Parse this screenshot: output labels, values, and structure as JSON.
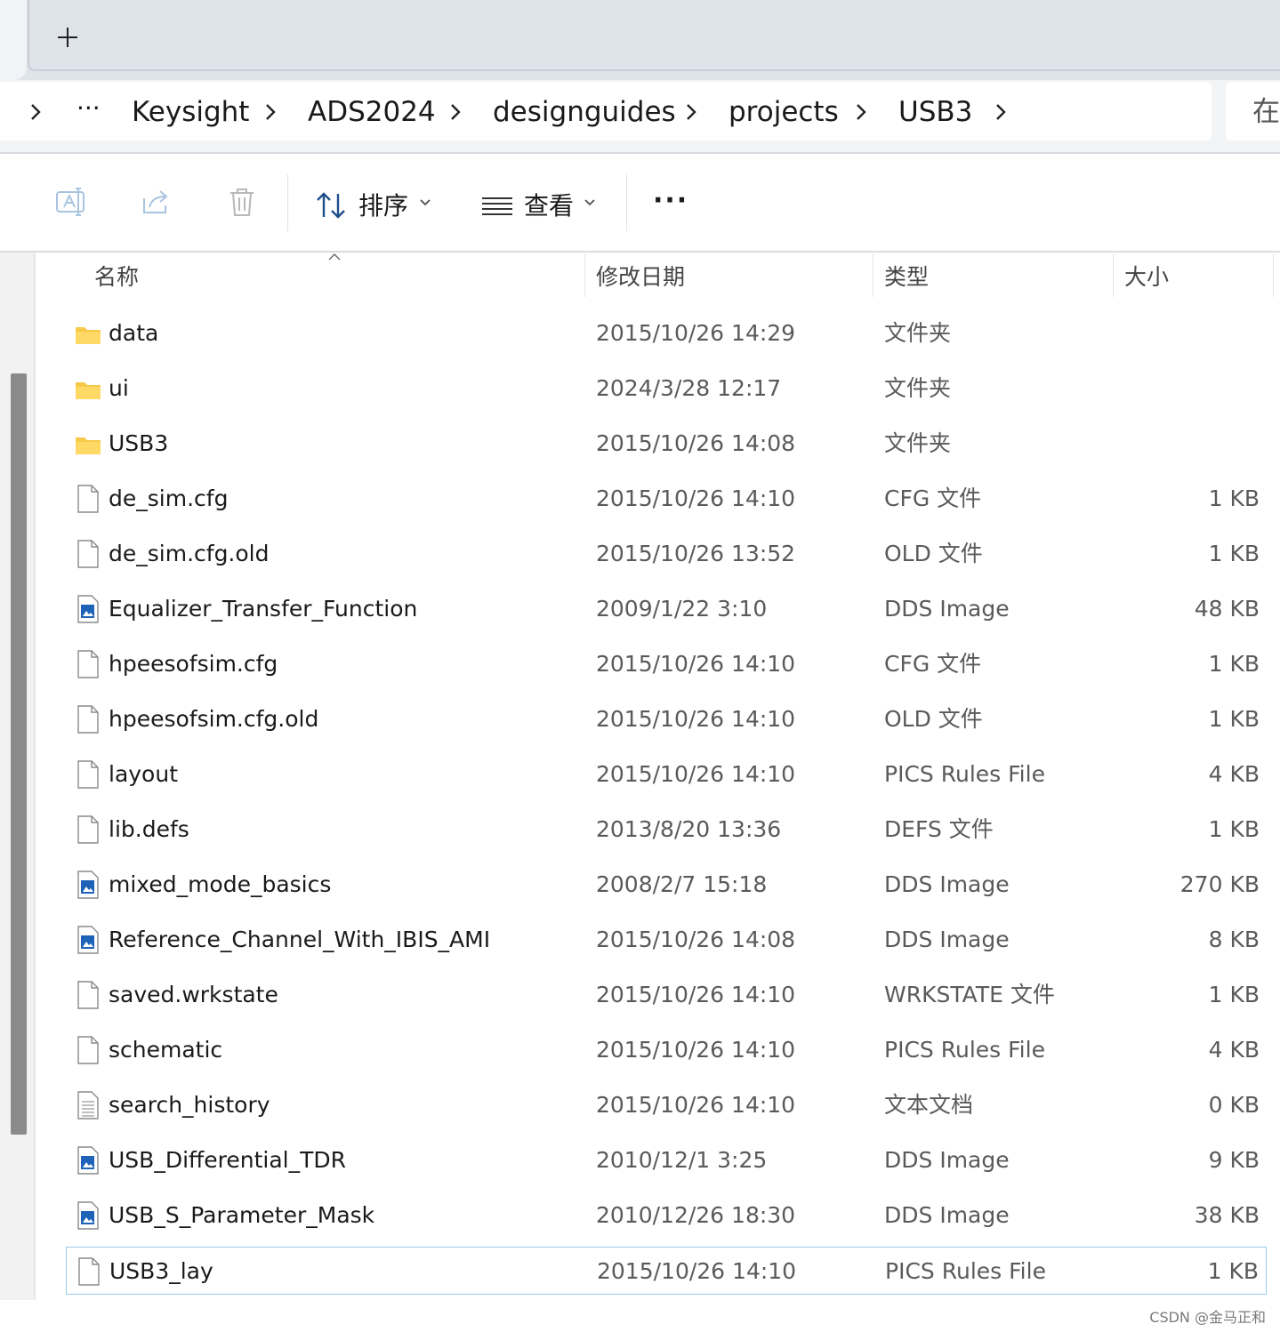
{
  "tabs": {
    "new_tab_icon": "plus-icon"
  },
  "breadcrumb": {
    "overflow": "···",
    "items": [
      "Keysight",
      "ADS2024",
      "designguides",
      "projects",
      "USB3"
    ]
  },
  "search": {
    "visible_text": "在"
  },
  "toolbar": {
    "rename_icon": "rename-icon",
    "share_icon": "share-icon",
    "delete_icon": "trash-icon",
    "sort_label": "排序",
    "view_label": "查看",
    "more_label": "···"
  },
  "columns": {
    "name": "名称",
    "date": "修改日期",
    "type": "类型",
    "size": "大小"
  },
  "colors": {
    "folder": "#f7c948",
    "selection_border": "#99c9e8",
    "dds_icon": "#1e63b8"
  },
  "files": [
    {
      "name": "data",
      "date": "2015/10/26 14:29",
      "type": "文件夹",
      "size": "",
      "icon": "folder"
    },
    {
      "name": "ui",
      "date": "2024/3/28 12:17",
      "type": "文件夹",
      "size": "",
      "icon": "folder"
    },
    {
      "name": "USB3",
      "date": "2015/10/26 14:08",
      "type": "文件夹",
      "size": "",
      "icon": "folder"
    },
    {
      "name": "de_sim.cfg",
      "date": "2015/10/26 14:10",
      "type": "CFG 文件",
      "size": "1 KB",
      "icon": "file"
    },
    {
      "name": "de_sim.cfg.old",
      "date": "2015/10/26 13:52",
      "type": "OLD 文件",
      "size": "1 KB",
      "icon": "file"
    },
    {
      "name": "Equalizer_Transfer_Function",
      "date": "2009/1/22 3:10",
      "type": "DDS Image",
      "size": "48 KB",
      "icon": "image"
    },
    {
      "name": "hpeesofsim.cfg",
      "date": "2015/10/26 14:10",
      "type": "CFG 文件",
      "size": "1 KB",
      "icon": "file"
    },
    {
      "name": "hpeesofsim.cfg.old",
      "date": "2015/10/26 14:10",
      "type": "OLD 文件",
      "size": "1 KB",
      "icon": "file"
    },
    {
      "name": "layout",
      "date": "2015/10/26 14:10",
      "type": "PICS Rules File",
      "size": "4 KB",
      "icon": "file"
    },
    {
      "name": "lib.defs",
      "date": "2013/8/20 13:36",
      "type": "DEFS 文件",
      "size": "1 KB",
      "icon": "file"
    },
    {
      "name": "mixed_mode_basics",
      "date": "2008/2/7 15:18",
      "type": "DDS Image",
      "size": "270 KB",
      "icon": "image"
    },
    {
      "name": "Reference_Channel_With_IBIS_AMI",
      "date": "2015/10/26 14:08",
      "type": "DDS Image",
      "size": "8 KB",
      "icon": "image"
    },
    {
      "name": "saved.wrkstate",
      "date": "2015/10/26 14:10",
      "type": "WRKSTATE 文件",
      "size": "1 KB",
      "icon": "file"
    },
    {
      "name": "schematic",
      "date": "2015/10/26 14:10",
      "type": "PICS Rules File",
      "size": "4 KB",
      "icon": "file"
    },
    {
      "name": "search_history",
      "date": "2015/10/26 14:10",
      "type": "文本文档",
      "size": "0 KB",
      "icon": "text"
    },
    {
      "name": "USB_Differential_TDR",
      "date": "2010/12/1 3:25",
      "type": "DDS Image",
      "size": "9 KB",
      "icon": "image"
    },
    {
      "name": "USB_S_Parameter_Mask",
      "date": "2010/12/26 18:30",
      "type": "DDS Image",
      "size": "38 KB",
      "icon": "image"
    },
    {
      "name": "USB3_lay",
      "date": "2015/10/26 14:10",
      "type": "PICS Rules File",
      "size": "1 KB",
      "icon": "file",
      "selected": true
    }
  ],
  "watermark": "CSDN @金马正和"
}
